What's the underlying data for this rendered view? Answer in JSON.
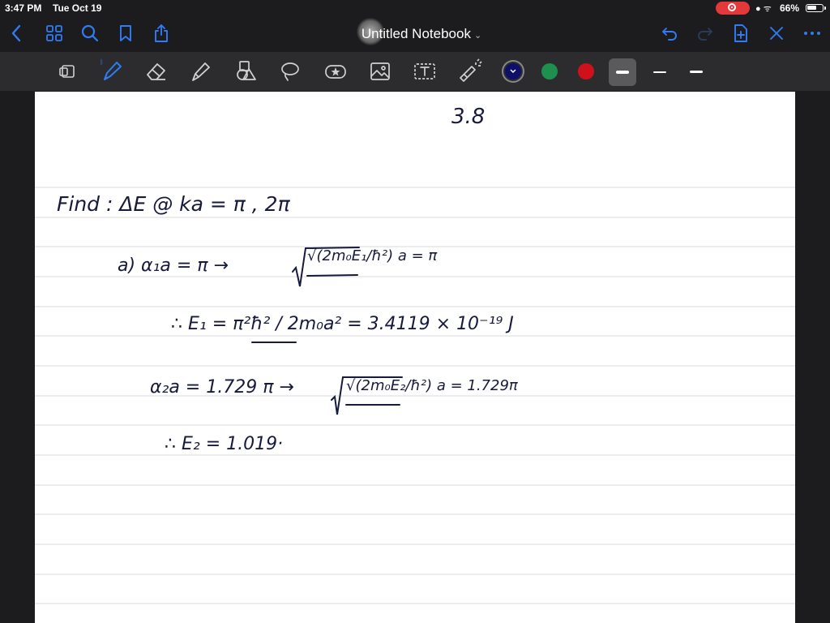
{
  "status_bar": {
    "time": "3:47 PM",
    "date": "Tue Oct 19",
    "battery_percent": "66%",
    "battery_level": 0.66,
    "recording_color": "#e5383b"
  },
  "navbar": {
    "title": "Untitled Notebook",
    "icons": [
      "back-icon",
      "grid-icon",
      "search-icon",
      "bookmark-icon",
      "share-icon",
      "undo-icon",
      "redo-icon",
      "add-page-icon",
      "close-icon",
      "more-icon"
    ]
  },
  "toolbar": {
    "tools": [
      "lasso-select-icon",
      "pen-icon",
      "eraser-icon",
      "highlighter-icon",
      "shapes-icon",
      "lasso-icon",
      "sticker-icon",
      "image-icon",
      "text-icon",
      "laser-pointer-icon"
    ],
    "selected_tool": "pen-icon",
    "colors": [
      "#0e0f6b",
      "#1e8f4e",
      "#d0111b"
    ],
    "selected_color": "#0e0f6b",
    "stroke_widths": [
      "thick",
      "thin",
      "medium"
    ],
    "selected_width": "thick"
  },
  "page": {
    "paper": "ruled",
    "ink_color": "#171a3d",
    "notes": {
      "problem_number": "3.8",
      "find_line": "Find :   ΔE @  ka = π  ,  2π",
      "part_a": "a)  α₁a = π  →",
      "sqrt1": "√(2m₀E₁/ħ²) a = π",
      "e1_line": "∴ E₁ =  π²ħ² / 2m₀a²   =   3.4119 × 10⁻¹⁹  J",
      "alpha2_line": "α₂a = 1.729 π  →",
      "sqrt2": "√(2m₀E₂/ħ²) a = 1.729π",
      "e2_line": "∴ E₂ =  1.019·"
    }
  }
}
